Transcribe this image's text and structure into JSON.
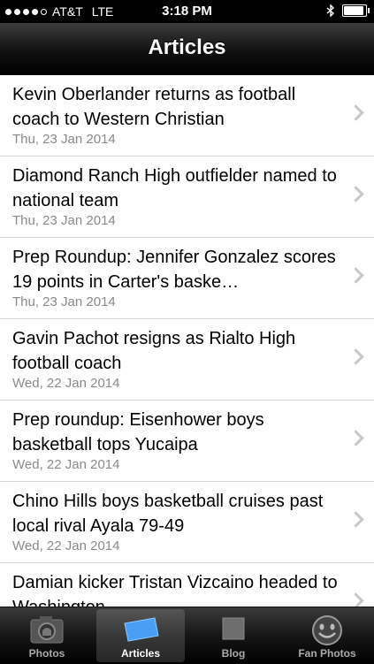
{
  "status_bar": {
    "carrier": "AT&T",
    "network": "LTE",
    "time": "3:18 PM"
  },
  "nav": {
    "title": "Articles"
  },
  "articles": [
    {
      "headline": "Kevin Oberlander returns as football coach to Western Christian",
      "date": "Thu, 23 Jan 2014"
    },
    {
      "headline": "Diamond Ranch High outfielder named to national team",
      "date": "Thu, 23 Jan 2014"
    },
    {
      "headline": "Prep Roundup: Jennifer Gonzalez scores 19 points in Carter's baske…",
      "date": "Thu, 23 Jan 2014"
    },
    {
      "headline": "Gavin Pachot resigns as Rialto High football coach",
      "date": "Wed, 22 Jan 2014"
    },
    {
      "headline": "Prep roundup: Eisenhower boys basketball tops Yucaipa",
      "date": "Wed, 22 Jan 2014"
    },
    {
      "headline": "Chino Hills boys basketball cruises past local rival Ayala 79-49",
      "date": "Wed, 22 Jan 2014"
    },
    {
      "headline": "Damian kicker Tristan Vizcaino headed to Washington",
      "date": ""
    }
  ],
  "tabs": [
    {
      "label": "Photos",
      "icon": "camera-icon"
    },
    {
      "label": "Articles",
      "icon": "articles-icon",
      "active": true
    },
    {
      "label": "Blog",
      "icon": "blog-icon"
    },
    {
      "label": "Fan Photos",
      "icon": "smiley-icon"
    }
  ]
}
